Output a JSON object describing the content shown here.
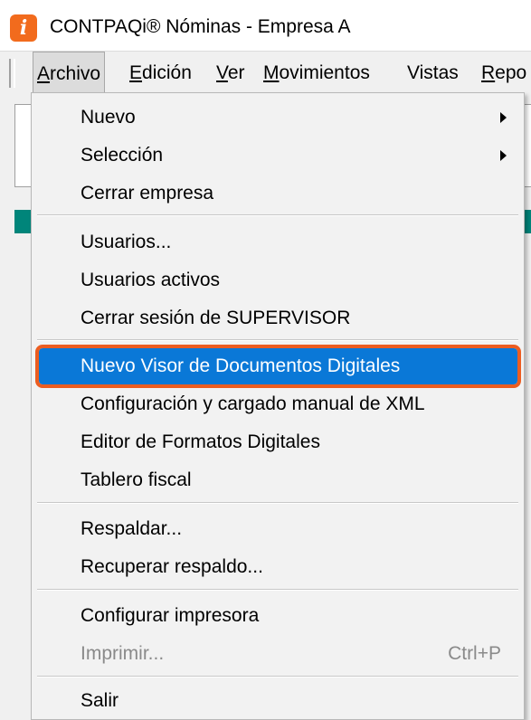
{
  "window": {
    "title": "CONTPAQi® Nóminas - Empresa A",
    "app_icon_glyph": "i",
    "app_icon_color": "#f26b1d"
  },
  "menubar": {
    "items": [
      {
        "label": "Archivo"
      },
      {
        "label": "Edición"
      },
      {
        "label": "Ver"
      },
      {
        "label": "Movimientos"
      },
      {
        "label": "Vistas"
      },
      {
        "label": "Repo"
      }
    ]
  },
  "archivo_menu": {
    "items": [
      {
        "label": "Nuevo",
        "submenu": true
      },
      {
        "label": "Selección",
        "submenu": true
      },
      {
        "label": "Cerrar empresa"
      },
      {
        "label": "Usuarios..."
      },
      {
        "label": "Usuarios activos"
      },
      {
        "label": "Cerrar sesión de SUPERVISOR"
      },
      {
        "label": "Nuevo Visor de Documentos Digitales",
        "highlighted": true
      },
      {
        "label": "Configuración y cargado manual de XML"
      },
      {
        "label": "Editor de Formatos Digitales"
      },
      {
        "label": "Tablero fiscal"
      },
      {
        "label": "Respaldar..."
      },
      {
        "label": "Recuperar respaldo..."
      },
      {
        "label": "Configurar impresora"
      },
      {
        "label": "Imprimir...",
        "shortcut": "Ctrl+P",
        "disabled": true
      },
      {
        "label": "Salir"
      }
    ]
  },
  "colors": {
    "highlight": "#0a78d7",
    "highlight_outline": "#ec5d21",
    "teal_strip": "#00857a"
  }
}
